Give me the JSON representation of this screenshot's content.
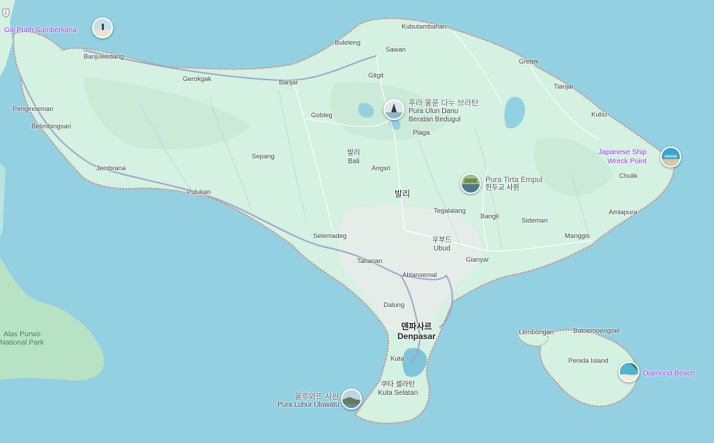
{
  "map": {
    "places": [
      {
        "id": "kubutambahan",
        "name": "Kubutambahan"
      },
      {
        "id": "buleleng",
        "name": "Buleleng"
      },
      {
        "id": "sawan",
        "name": "Sawan"
      },
      {
        "id": "banjuwedang",
        "name": "Banjuwedang"
      },
      {
        "id": "gretek",
        "name": "Gretek"
      },
      {
        "id": "gitgit",
        "name": "Gitgit"
      },
      {
        "id": "gerokgak",
        "name": "Gerokgak"
      },
      {
        "id": "banjar",
        "name": "Banjar"
      },
      {
        "id": "tianjar",
        "name": "Tianjar"
      },
      {
        "id": "penginoeman",
        "name": "Penginoeman"
      },
      {
        "id": "gobleg",
        "name": "Gobleg"
      },
      {
        "id": "kubu",
        "name": "Kubu"
      },
      {
        "id": "belimbingsari",
        "name": "Belimbingsari"
      },
      {
        "id": "plaga",
        "name": "Plaga"
      },
      {
        "id": "sepang",
        "name": "Sepang"
      },
      {
        "id": "angsri",
        "name": "Angsri"
      },
      {
        "id": "jembrana",
        "name": "Jembrana"
      },
      {
        "id": "chulik",
        "name": "Chulik"
      },
      {
        "id": "pulukan",
        "name": "Pulukan"
      },
      {
        "id": "tegalalang",
        "name": "Tegalalang"
      },
      {
        "id": "amlapura",
        "name": "Amlapura"
      },
      {
        "id": "bangli",
        "name": "Bangli"
      },
      {
        "id": "sideman",
        "name": "Sideman"
      },
      {
        "id": "selemadeg",
        "name": "Selemadeg"
      },
      {
        "id": "manggis",
        "name": "Manggis"
      },
      {
        "id": "gianyar",
        "name": "Gianyar"
      },
      {
        "id": "tabanan",
        "name": "Tabanan"
      },
      {
        "id": "abiansemal",
        "name": "Abiansemal"
      },
      {
        "id": "dalung",
        "name": "Dalung"
      },
      {
        "id": "lembongan",
        "name": "Lembongan"
      },
      {
        "id": "batoemoengoel",
        "name": "Batoemoengoel"
      },
      {
        "id": "kuta",
        "name": "Kuta"
      },
      {
        "id": "penida",
        "name": "Penida Island"
      }
    ],
    "bali_label": {
      "ko": "발리",
      "en": "Bali"
    },
    "bali_big": "발리",
    "ubud": {
      "ko": "우부드",
      "en": "Ubud"
    },
    "denpasar": {
      "ko": "덴파사르",
      "en": "Denpasar"
    },
    "kuta_selatan": {
      "ko": "쿠타 셀라탄",
      "en": "Kuta Selatan"
    },
    "park": {
      "line1": "Alas Purwo",
      "line2": "National Park"
    },
    "road_shield": "1",
    "pois": [
      {
        "id": "gili",
        "name": "Gili Putih Sumberkima"
      },
      {
        "id": "ulun_danu",
        "name_ko": "푸라 울룬 다누 브라탄",
        "name_en1": "Pura Ulun Danu",
        "name_en2": "Beratan Bedugul"
      },
      {
        "id": "tirta",
        "name": "Pura Tirta Empul",
        "name_ko": "힌두교 사원"
      },
      {
        "id": "shipwreck",
        "line1": "Japanese Ship",
        "line2": "Wreck Point"
      },
      {
        "id": "diamond",
        "name": "Diamond Beach"
      },
      {
        "id": "uluwatu",
        "name_ko": "울루와뜨 사원",
        "name_en": "Pura Luhur Uluwatu"
      }
    ],
    "colors": {
      "water": "#92d0e2",
      "land": "#d4f1e1",
      "border": "#e07060",
      "poi": "#9334e6",
      "road": "#9aa5c9"
    }
  }
}
